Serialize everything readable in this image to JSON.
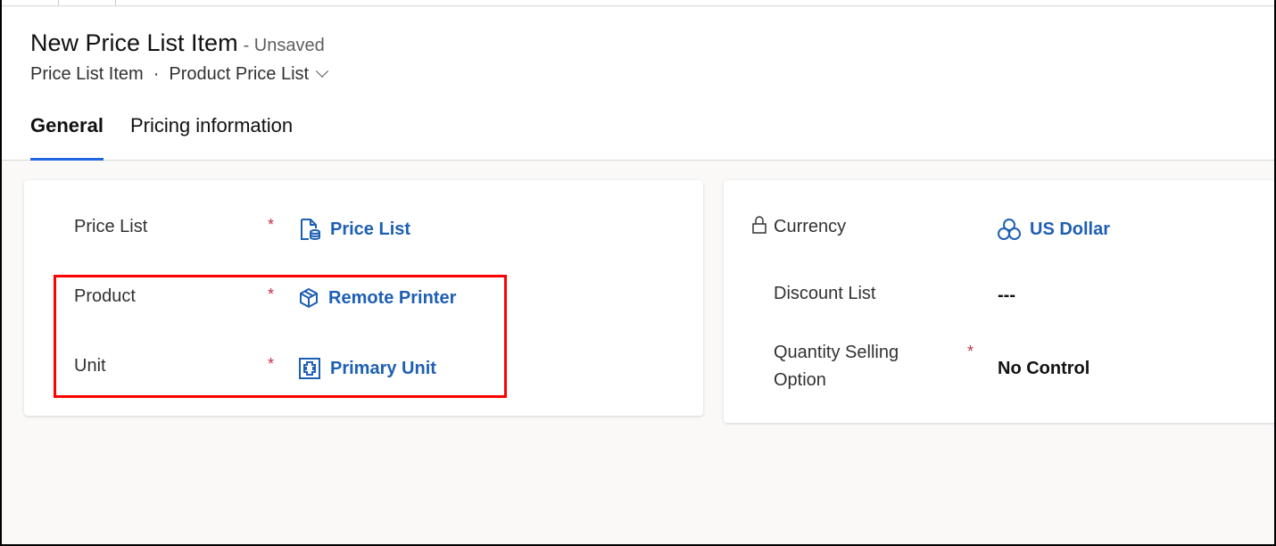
{
  "header": {
    "title": "New Price List Item",
    "status": "- Unsaved",
    "entity": "Price List Item",
    "separator": "·",
    "form_selector": "Product Price List"
  },
  "tabs": [
    {
      "label": "General",
      "active": true
    },
    {
      "label": "Pricing information",
      "active": false
    }
  ],
  "left_fields": [
    {
      "label": "Price List",
      "required": "*",
      "value": "Price List",
      "icon": "price-list-icon"
    },
    {
      "label": "Product",
      "required": "*",
      "value": "Remote Printer",
      "icon": "product-box-icon"
    },
    {
      "label": "Unit",
      "required": "*",
      "value": "Primary Unit",
      "icon": "unit-icon"
    }
  ],
  "right_fields": [
    {
      "label": "Currency",
      "locked": true,
      "value": "US Dollar",
      "icon": "currency-icon"
    },
    {
      "label": "Discount List",
      "value": "---"
    },
    {
      "label": "Quantity Selling Option",
      "required": "*",
      "value": "No Control"
    }
  ],
  "colors": {
    "accent": "#2266e3",
    "link": "#1e5fb4",
    "required": "#c4314b",
    "highlight": "#ff0000"
  }
}
